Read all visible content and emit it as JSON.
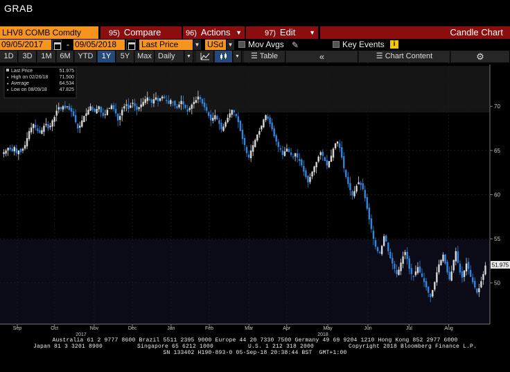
{
  "window": {
    "title": "GRAB"
  },
  "toolbar": {
    "ticker": "LHV8 COMB Comdty",
    "compare_num": "95)",
    "compare_label": "Compare",
    "actions_num": "96)",
    "actions_label": "Actions",
    "edit_num": "97)",
    "edit_label": "Edit",
    "chart_type": "Candle Chart"
  },
  "controls": {
    "start_date": "09/05/2017",
    "end_date": "09/05/2018",
    "dash": "-",
    "field": "Last Price",
    "currency": "USd",
    "mov_avgs": "Mov Avgs",
    "key_events": "Key Events",
    "info_glyph": "i"
  },
  "periods": [
    {
      "label": "1D",
      "active": false
    },
    {
      "label": "3D",
      "active": false
    },
    {
      "label": "1M",
      "active": false
    },
    {
      "label": "6M",
      "active": false
    },
    {
      "label": "YTD",
      "active": false
    },
    {
      "label": "1Y",
      "active": true
    },
    {
      "label": "5Y",
      "active": false
    },
    {
      "label": "Max",
      "active": false
    }
  ],
  "frequency": "Daily",
  "table_label": "Table",
  "chart_content_label": "Chart Content",
  "collapse_glyph": "«",
  "legend": {
    "last_price_label": "Last Price",
    "last_price": "51.975",
    "high_label": "High on 02/26/18",
    "high": "71.500",
    "average_label": "Average",
    "average": "64.534",
    "low_label": "Low on 08/09/18",
    "low": "47.825"
  },
  "colors": {
    "accent": "#f7941d",
    "button_red": "#8b0d0d",
    "up_candle": "#d9d9d9",
    "down_candle": "#2e86de"
  },
  "chart_data": {
    "type": "candlestick",
    "title": "",
    "ylabel": "",
    "ylim": [
      45.5,
      73
    ],
    "y_ticks": [
      "70",
      "65",
      "60",
      "55",
      "50"
    ],
    "x_ticks": [
      "Sep",
      "Oct",
      "Nov",
      "Dec",
      "Jan",
      "Feb",
      "Mar",
      "Apr",
      "May",
      "Jun",
      "Jul",
      "Aug"
    ],
    "year_labels": [
      "2017",
      "2018"
    ],
    "last_value_tag": "51.975",
    "series": [
      {
        "name": "LHV8 COMB Comdty",
        "close": [
          64.8,
          65.0,
          65.3,
          65.1,
          64.9,
          65.4,
          64.7,
          65.0,
          64.8,
          65.2,
          65.6,
          66.4,
          67.2,
          67.6,
          68.0,
          67.6,
          67.2,
          67.0,
          67.3,
          67.8,
          68.0,
          67.5,
          67.8,
          68.4,
          68.8,
          69.5,
          69.9,
          69.7,
          70.0,
          69.8,
          70.0,
          69.6,
          69.4,
          68.9,
          68.2,
          67.5,
          67.8,
          68.4,
          68.9,
          69.2,
          69.6,
          70.0,
          69.6,
          69.4,
          69.7,
          70.0,
          69.3,
          68.9,
          69.1,
          69.6,
          69.8,
          70.1,
          69.7,
          69.2,
          68.4,
          68.9,
          69.6,
          70.0,
          70.2,
          69.7,
          70.1,
          70.4,
          70.0,
          69.6,
          69.9,
          70.2,
          70.5,
          70.8,
          71.0,
          70.7,
          70.4,
          70.8,
          71.0,
          70.6,
          70.9,
          71.1,
          70.9,
          70.6,
          70.3,
          70.7,
          70.5,
          70.1,
          69.8,
          70.2,
          70.6,
          70.2,
          69.8,
          69.4,
          69.8,
          70.2,
          70.5,
          70.7,
          71.1,
          70.8,
          70.3,
          69.9,
          69.5,
          68.9,
          68.4,
          68.7,
          69.0,
          68.5,
          68.0,
          67.4,
          67.7,
          68.2,
          68.7,
          69.2,
          69.6,
          69.3,
          68.9,
          68.2,
          67.2,
          66.3,
          65.6,
          64.7,
          64.2,
          65.0,
          65.6,
          66.2,
          66.8,
          67.2,
          67.8,
          68.5,
          69.0,
          68.6,
          68.0,
          67.4,
          66.6,
          66.0,
          65.4,
          65.1,
          64.5,
          64.9,
          65.2,
          64.8,
          64.5,
          64.3,
          64.7,
          64.2,
          63.8,
          63.3,
          62.6,
          62.0,
          61.4,
          62.0,
          62.6,
          63.2,
          63.7,
          64.3,
          64.8,
          64.4,
          63.8,
          63.3,
          63.8,
          64.4,
          65.2,
          65.8,
          66.0,
          65.3,
          64.2,
          63.0,
          62.0,
          61.2,
          60.5,
          59.9,
          60.4,
          61.0,
          61.4,
          61.1,
          60.6,
          59.6,
          58.4,
          57.2,
          56.1,
          55.0,
          54.1,
          53.6,
          53.4,
          54.2,
          55.3,
          54.7,
          53.6,
          52.8,
          52.2,
          51.6,
          51.0,
          51.5,
          52.3,
          53.0,
          53.5,
          52.7,
          51.6,
          51.0,
          50.7,
          51.3,
          51.8,
          51.2,
          50.7,
          50.1,
          49.5,
          48.9,
          48.4,
          49.2,
          50.1,
          51.2,
          52.1,
          52.6,
          53.2,
          52.2,
          51.2,
          50.4,
          51.3,
          52.6,
          53.6,
          52.3,
          51.2,
          50.6,
          51.4,
          52.2,
          51.6,
          50.7,
          50.1,
          49.5,
          48.9,
          49.4,
          50.2,
          51.0,
          51.975
        ]
      }
    ]
  },
  "footer": {
    "line1": "Australia 61 2 9777 8600 Brazil 5511 2395 9000 Europe 44 20 7330 7500 Germany 49 69 9204 1210 Hong Kong 852 2977 6000",
    "line2": "Japan 81 3 3201 8900          Singapore 65 6212 1000          U.S. 1 212 318 2000          Copyright 2018 Bloomberg Finance L.P.",
    "line3": "SN 133402 H190-893-0 05-Sep-18 20:38:44 BST  GMT+1:00"
  }
}
